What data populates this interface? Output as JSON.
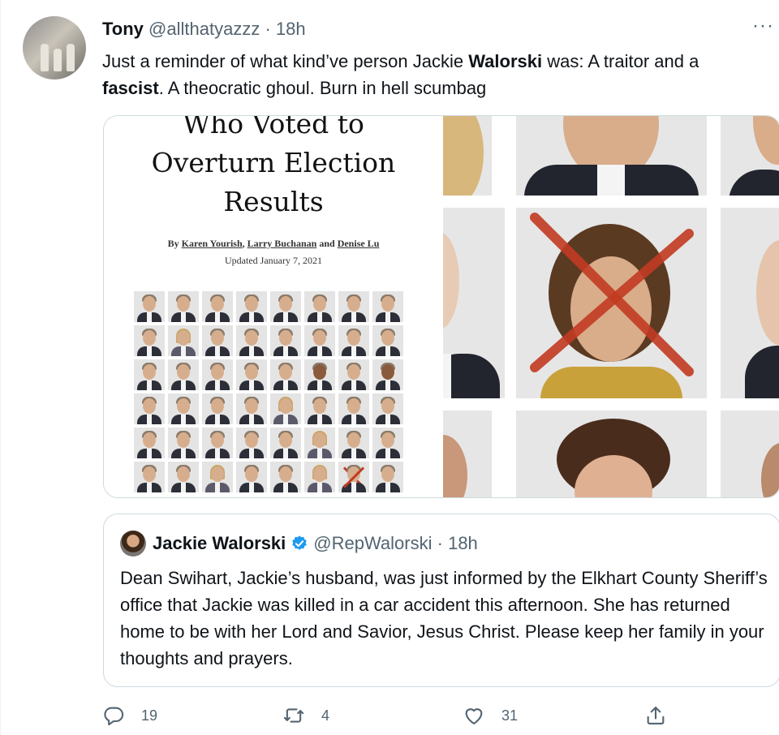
{
  "tweet": {
    "author_name": "Tony",
    "author_handle": "@allthatyazzz",
    "separator": "·",
    "time": "18h",
    "more_label": "···",
    "text_parts": [
      "Just a reminder of what kind’ve person Jackie ",
      "Walorski",
      " was: A traitor and a ",
      "fascist",
      ". A theocratic ghoul. Burn in hell scumbag"
    ]
  },
  "media": {
    "headline_lines": [
      "Who Voted to",
      "Overturn Election",
      "Results"
    ],
    "byline_prefix": "By ",
    "authors": [
      "Karen Yourish",
      "Larry Buchanan",
      "Denise Lu"
    ],
    "byline_sep1": ", ",
    "byline_sep2": " and ",
    "updated": "Updated January 7, 2021"
  },
  "quoted_tweet": {
    "author_name": "Jackie Walorski",
    "author_handle": "@RepWalorski",
    "separator": "·",
    "time": "18h",
    "verified": true,
    "text": "Dean Swihart, Jackie’s husband, was just informed by the Elkhart County Sheriff’s office that Jackie was killed in a car accident this afternoon. She has returned home to be with her Lord and Savior, Jesus Christ. Please keep her family in your thoughts and prayers."
  },
  "actions": {
    "reply_count": "19",
    "retweet_count": "4",
    "like_count": "31",
    "icons": [
      "reply-icon",
      "retweet-icon",
      "like-icon",
      "share-icon"
    ]
  },
  "colors": {
    "text": "#0f1419",
    "secondary": "#536471",
    "border": "#cfd9de",
    "verified": "#1d9bf0",
    "cross": "#c23b22"
  }
}
